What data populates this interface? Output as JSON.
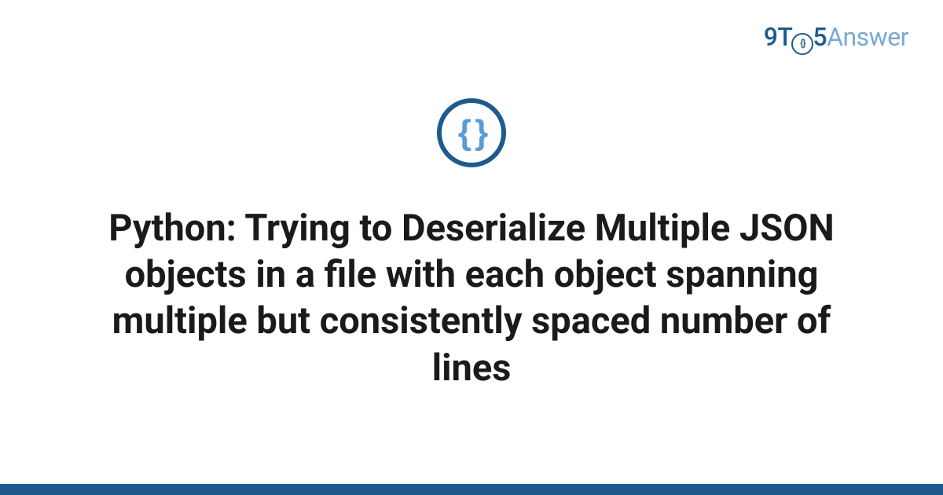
{
  "brand": {
    "part1": "9T",
    "inner": "{}",
    "part2": "5",
    "part3": "Answer"
  },
  "icon": {
    "glyph": "{ }"
  },
  "title": "Python: Trying to Deserialize Multiple JSON objects in a file with each object spanning multiple but consistently spaced number of lines"
}
